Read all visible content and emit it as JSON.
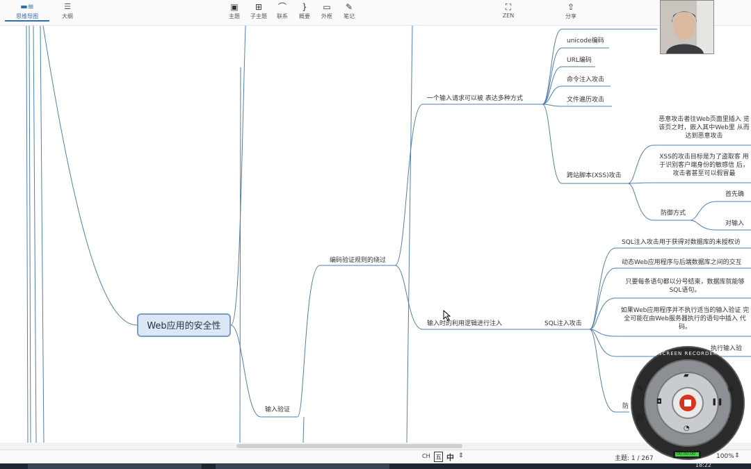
{
  "toolbar": {
    "tabs": [
      {
        "label": "思维导图"
      },
      {
        "label": "大纲"
      }
    ],
    "buttons": [
      {
        "label": "主题"
      },
      {
        "label": "子主题"
      },
      {
        "label": "联系"
      },
      {
        "label": "概要"
      },
      {
        "label": "外框"
      },
      {
        "label": "笔记"
      },
      {
        "label": "ZEN"
      },
      {
        "label": "分享"
      }
    ]
  },
  "mindmap": {
    "root": "Web应用的安全性",
    "input_validation": "输入验证",
    "bypass": "编码验证规则的绕过",
    "many_ways": "一个输入请求可以被 表达多种方式",
    "many_ways_children": [
      "unicode编码",
      "URL编码",
      "命令注入攻击",
      "文件遍历攻击"
    ],
    "xss": "跨站脚本(XSS)攻击",
    "xss_desc1": "恶意攻击者往Web页面里插入 览该页之时，嵌入其中Web里 从而达到恶意攻击",
    "xss_desc2": "XSS的攻击目标是为了盗取客 用于识别客户端身份的敏感信 后，攻击者甚至可以假冒最",
    "defense": "防御方式",
    "defense_children": [
      "首先确",
      "对输入"
    ],
    "logic_inject": "输入时的利用逻辑进行注入",
    "sqli": "SQL注入攻击",
    "sqli_children": [
      "SQL注入攻击用于获得对数据库的未授权访",
      "动态Web应用程序与后端数据库之间的交互",
      "只要每条语句都以分号结束，数据库就能够 SQL语句。",
      "如果Web应用程序并不执行适当的输入验证 完全可能在由Web服务器执行的语句中插入 代码。",
      "执行输入验"
    ],
    "partial_left": "防"
  },
  "statusbar": {
    "ime": "CH",
    "ime2": "五",
    "ime3": "中",
    "topic_count": "主题: 1 / 267",
    "zoom": "100%",
    "clock": "18:22"
  },
  "recorder": {
    "label": "SCREEN RECORDER",
    "timer": "00:00:00"
  }
}
